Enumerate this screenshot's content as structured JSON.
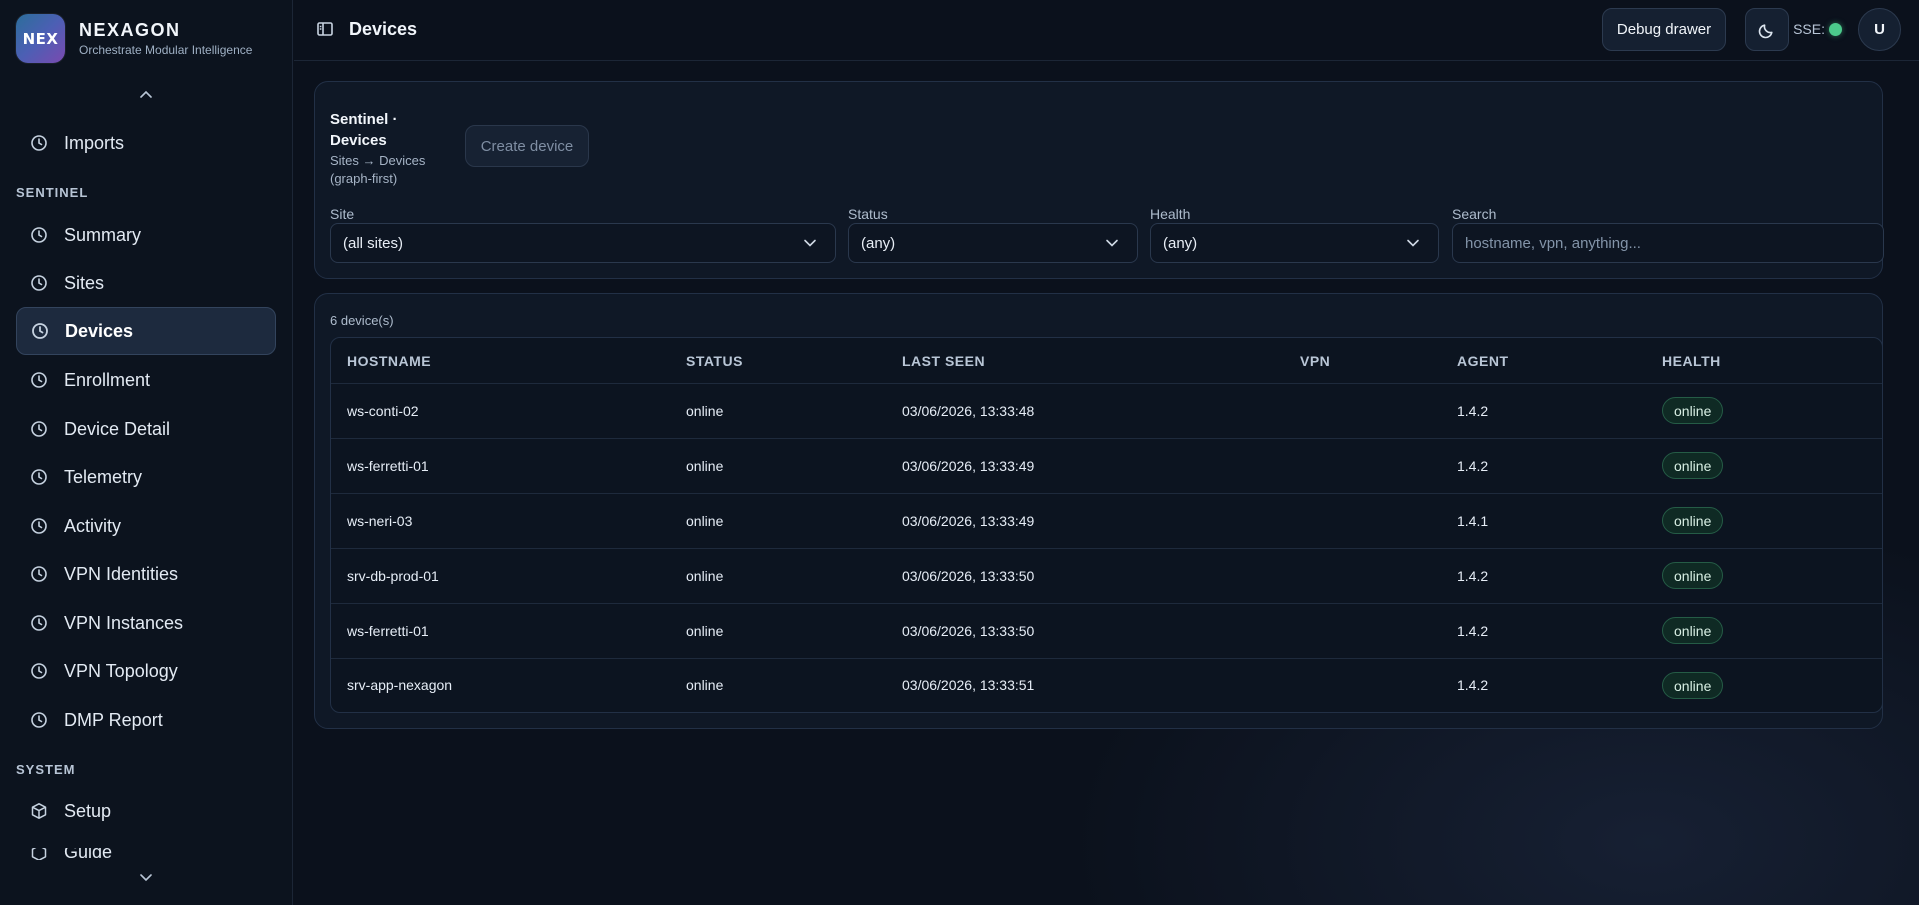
{
  "brand": {
    "logo_text": "NEX",
    "name": "NEXAGON",
    "tagline": "Orchestrate Modular Intelligence"
  },
  "sidebar": {
    "top_item": {
      "label": "Imports",
      "icon": "clock-icon"
    },
    "sections": [
      {
        "label": "SENTINEL",
        "items": [
          {
            "label": "Summary",
            "icon": "clock-icon",
            "active": false
          },
          {
            "label": "Sites",
            "icon": "clock-icon",
            "active": false
          },
          {
            "label": "Devices",
            "icon": "clock-icon",
            "active": true
          },
          {
            "label": "Enrollment",
            "icon": "clock-icon",
            "active": false
          },
          {
            "label": "Device Detail",
            "icon": "clock-icon",
            "active": false
          },
          {
            "label": "Telemetry",
            "icon": "clock-icon",
            "active": false
          },
          {
            "label": "Activity",
            "icon": "clock-icon",
            "active": false
          },
          {
            "label": "VPN Identities",
            "icon": "clock-icon",
            "active": false
          },
          {
            "label": "VPN Instances",
            "icon": "clock-icon",
            "active": false
          },
          {
            "label": "VPN Topology",
            "icon": "clock-icon",
            "active": false
          },
          {
            "label": "DMP Report",
            "icon": "clock-icon",
            "active": false
          }
        ]
      },
      {
        "label": "SYSTEM",
        "items": [
          {
            "label": "Setup",
            "icon": "cube-icon",
            "active": false
          },
          {
            "label": "Guide",
            "icon": "cube-icon",
            "active": false
          }
        ]
      }
    ]
  },
  "topbar": {
    "title": "Devices",
    "debug_label": "Debug drawer",
    "theme_icon": "moon-icon",
    "sse_label": "SSE:",
    "sse_status_color": "#4ccb8c",
    "avatar_initial": "U"
  },
  "filters": {
    "title": "Sentinel · Devices",
    "subtitle": "Sites → Devices (graph-first)",
    "create_label": "Create device",
    "site": {
      "label": "Site",
      "value": "(all sites)"
    },
    "status": {
      "label": "Status",
      "value": "(any)"
    },
    "health": {
      "label": "Health",
      "value": "(any)"
    },
    "search": {
      "label": "Search",
      "placeholder": "hostname, vpn, anything..."
    }
  },
  "table": {
    "count_text": "6 device(s)",
    "columns": [
      "HOSTNAME",
      "STATUS",
      "LAST SEEN",
      "VPN",
      "AGENT",
      "HEALTH"
    ],
    "rows": [
      {
        "hostname": "ws-conti-02",
        "status": "online",
        "last_seen": "03/06/2026, 13:33:48",
        "vpn": "",
        "agent": "1.4.2",
        "health": "online"
      },
      {
        "hostname": "ws-ferretti-01",
        "status": "online",
        "last_seen": "03/06/2026, 13:33:49",
        "vpn": "",
        "agent": "1.4.2",
        "health": "online"
      },
      {
        "hostname": "ws-neri-03",
        "status": "online",
        "last_seen": "03/06/2026, 13:33:49",
        "vpn": "",
        "agent": "1.4.1",
        "health": "online"
      },
      {
        "hostname": "srv-db-prod-01",
        "status": "online",
        "last_seen": "03/06/2026, 13:33:50",
        "vpn": "",
        "agent": "1.4.2",
        "health": "online"
      },
      {
        "hostname": "ws-ferretti-01",
        "status": "online",
        "last_seen": "03/06/2026, 13:33:50",
        "vpn": "",
        "agent": "1.4.2",
        "health": "online"
      },
      {
        "hostname": "srv-app-nexagon",
        "status": "online",
        "last_seen": "03/06/2026, 13:33:51",
        "vpn": "",
        "agent": "1.4.2",
        "health": "online"
      }
    ]
  }
}
